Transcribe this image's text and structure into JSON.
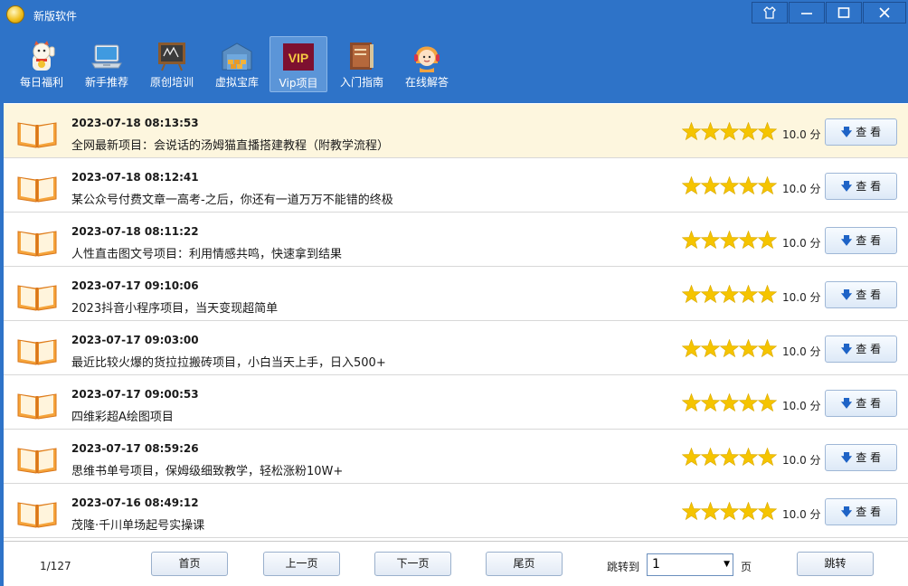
{
  "window": {
    "title": "新版软件",
    "buttons": [
      "skin-icon",
      "minimize-icon",
      "maximize-icon",
      "close-icon"
    ]
  },
  "toolbar": {
    "items": [
      {
        "label": "每日福利",
        "icon": "lucky-cat-icon"
      },
      {
        "label": "新手推荐",
        "icon": "laptop-icon"
      },
      {
        "label": "原创培训",
        "icon": "blackboard-icon"
      },
      {
        "label": "虚拟宝库",
        "icon": "warehouse-icon"
      },
      {
        "label": "Vip项目",
        "icon": "vip-icon",
        "active": true,
        "badge": "VIP"
      },
      {
        "label": "入门指南",
        "icon": "guide-book-icon"
      },
      {
        "label": "在线解答",
        "icon": "support-agent-icon"
      }
    ]
  },
  "list": {
    "rows": [
      {
        "date": "2023-07-18 08:13:53",
        "title": "全网最新项目：会说话的汤姆猫直播搭建教程（附教学流程）",
        "rating": 5,
        "score": "10.0 分",
        "button": "查 看",
        "highlight": true
      },
      {
        "date": "2023-07-18 08:12:41",
        "title": "某公众号付费文章一高考-之后，你还有一道万万不能错的终极",
        "rating": 5,
        "score": "10.0 分",
        "button": "查 看"
      },
      {
        "date": "2023-07-18 08:11:22",
        "title": "人性直击图文号项目：利用情感共鸣，快速拿到结果",
        "rating": 5,
        "score": "10.0 分",
        "button": "查 看"
      },
      {
        "date": "2023-07-17 09:10:06",
        "title": "2023抖音小程序项目，当天变现超简单",
        "rating": 5,
        "score": "10.0 分",
        "button": "查 看"
      },
      {
        "date": "2023-07-17 09:03:00",
        "title": "最近比较火爆的货拉拉搬砖项目，小白当天上手，日入500+",
        "rating": 5,
        "score": "10.0 分",
        "button": "查 看"
      },
      {
        "date": "2023-07-17 09:00:53",
        "title": "四维彩超A绘图项目",
        "rating": 5,
        "score": "10.0 分",
        "button": "查 看"
      },
      {
        "date": "2023-07-17 08:59:26",
        "title": "思维书单号项目，保姆级细致教学，轻松涨粉10W+",
        "rating": 5,
        "score": "10.0 分",
        "button": "查 看"
      },
      {
        "date": "2023-07-16 08:49:12",
        "title": "茂隆·千川单场起号实操课",
        "rating": 5,
        "score": "10.0 分",
        "button": "查 看"
      }
    ]
  },
  "pagination": {
    "info": "1/127",
    "first": "首页",
    "prev": "上一页",
    "next": "下一页",
    "last": "尾页",
    "jump_label": "跳转到",
    "jump_value": "1",
    "unit": "页",
    "go": "跳转"
  },
  "colors": {
    "chrome": "#2e73c8",
    "highlight_row": "#fdf6de",
    "star": "#f5c400"
  }
}
